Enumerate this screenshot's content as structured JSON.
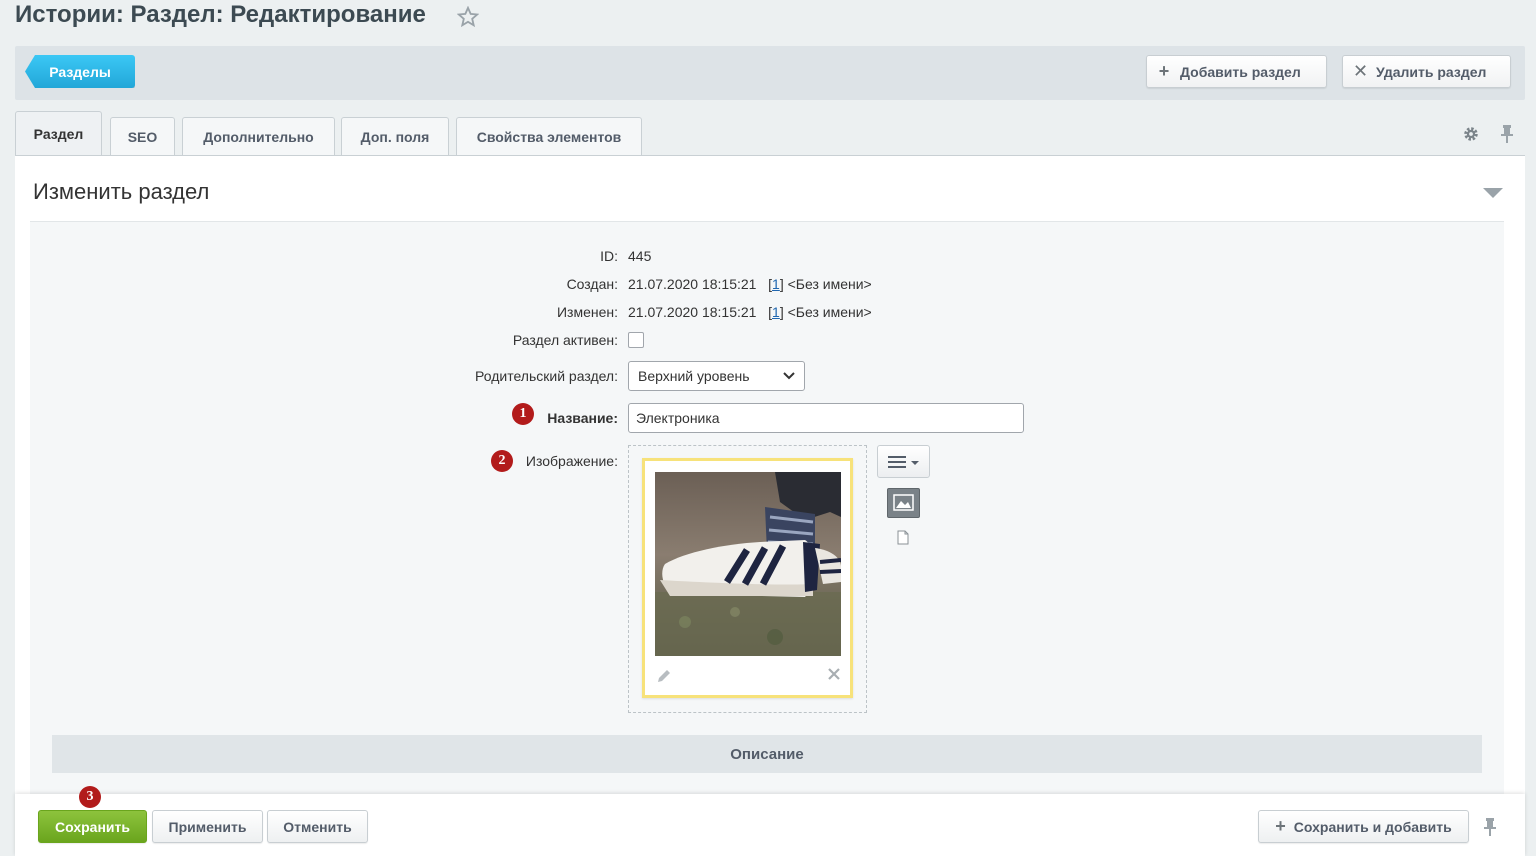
{
  "header": {
    "title": "Истории: Раздел: Редактирование",
    "favorite_icon": "star-icon"
  },
  "toolbar": {
    "back_label": "Разделы",
    "add_label": "Добавить раздел",
    "delete_label": "Удалить раздел"
  },
  "tabs": [
    {
      "label": "Раздел",
      "active": true
    },
    {
      "label": "SEO",
      "active": false
    },
    {
      "label": "Дополнительно",
      "active": false
    },
    {
      "label": "Доп. поля",
      "active": false
    },
    {
      "label": "Свойства элементов",
      "active": false
    }
  ],
  "panel": {
    "title": "Изменить раздел"
  },
  "form": {
    "id_label": "ID:",
    "id_value": "445",
    "created_label": "Создан:",
    "created_date": "21.07.2020 18:15:21",
    "created_user_id": "1",
    "created_user_name": "<Без имени>",
    "modified_label": "Изменен:",
    "modified_date": "21.07.2020 18:15:21",
    "modified_user_id": "1",
    "modified_user_name": "<Без имени>",
    "active_label": "Раздел активен:",
    "active_checked": false,
    "parent_label": "Родительский раздел:",
    "parent_value": "Верхний уровень",
    "name_label": "Название:",
    "name_value": "Электроника",
    "image_label": "Изображение:"
  },
  "markers": [
    "1",
    "2",
    "3"
  ],
  "description_section": {
    "title": "Описание"
  },
  "footer": {
    "save_label": "Сохранить",
    "apply_label": "Применить",
    "cancel_label": "Отменить",
    "save_add_label": "Сохранить и добавить"
  },
  "colors": {
    "accent_blue": "#2fc6f6",
    "save_green": "#7ab82d",
    "marker_red": "#b21b1b",
    "image_frame": "#f7e27a"
  }
}
